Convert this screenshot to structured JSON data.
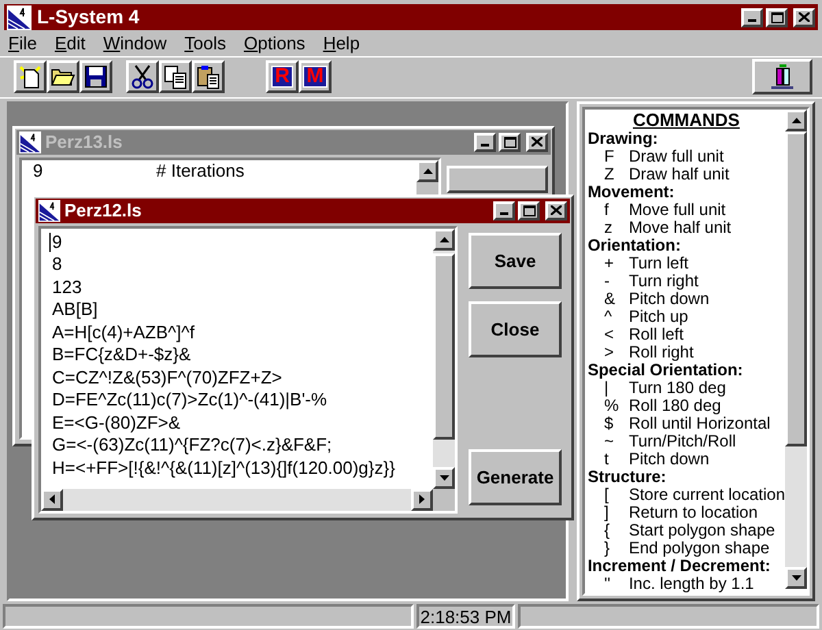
{
  "window": {
    "title": "L-System 4"
  },
  "menu": [
    "File",
    "Edit",
    "Window",
    "Tools",
    "Options",
    "Help"
  ],
  "toolbar": {
    "badges": [
      "R",
      "M"
    ]
  },
  "documents": [
    {
      "title": "Perz13.ls",
      "active": false,
      "lines": [
        {
          "value": "9",
          "comment": "# Iterations"
        }
      ]
    },
    {
      "title": "Perz12.ls",
      "active": true,
      "lines": [
        "9",
        "8",
        "123",
        "AB[B]",
        "A=H[c(4)+AZB^]^f",
        "B=FC{z&D+-$z}&",
        "C=CZ^!Z&(53)F^(70)ZFZ+Z>",
        "D=FE^Zc(11)c(7)>Zc(1)^-(41)|B'-%",
        "E=<G-(80)ZF>&",
        "G=<-(63)Zc(11)^{FZ?c(7)<.z}&F&F;",
        "H=<+FF>[!{&!^{&(11)[z]^(13){]f(120.00)g}z}}"
      ],
      "buttons": [
        "Save",
        "Close",
        "Generate"
      ]
    }
  ],
  "commands": {
    "heading": "COMMANDS",
    "sections": [
      {
        "title": "Drawing:",
        "items": [
          {
            "symbol": "F",
            "text": "Draw full unit"
          },
          {
            "symbol": "Z",
            "text": "Draw half unit"
          }
        ]
      },
      {
        "title": "Movement:",
        "items": [
          {
            "symbol": "f",
            "text": "Move full unit"
          },
          {
            "symbol": "z",
            "text": "Move half unit"
          }
        ]
      },
      {
        "title": "Orientation:",
        "items": [
          {
            "symbol": "+",
            "text": "Turn left"
          },
          {
            "symbol": "-",
            "text": "Turn right"
          },
          {
            "symbol": "&",
            "text": "Pitch down"
          },
          {
            "symbol": "^",
            "text": "Pitch up"
          },
          {
            "symbol": "<",
            "text": "Roll left"
          },
          {
            "symbol": ">",
            "text": "Roll right"
          }
        ]
      },
      {
        "title": "Special Orientation:",
        "items": [
          {
            "symbol": "|",
            "text": "Turn 180 deg"
          },
          {
            "symbol": "%",
            "text": "Roll 180 deg"
          },
          {
            "symbol": "$",
            "text": "Roll until Horizontal"
          },
          {
            "symbol": "~",
            "text": "Turn/Pitch/Roll"
          },
          {
            "symbol": "t",
            "text": "Pitch down"
          }
        ]
      },
      {
        "title": "Structure:",
        "items": [
          {
            "symbol": "[",
            "text": "Store current location"
          },
          {
            "symbol": "]",
            "text": "Return to location"
          },
          {
            "symbol": "{",
            "text": "Start polygon shape"
          },
          {
            "symbol": "}",
            "text": "End polygon shape"
          }
        ]
      },
      {
        "title": "Increment / Decrement:",
        "items": [
          {
            "symbol": "''",
            "text": "Inc. length by 1.1"
          }
        ]
      }
    ]
  },
  "status_bar": {
    "time": "2:18:53 PM"
  }
}
